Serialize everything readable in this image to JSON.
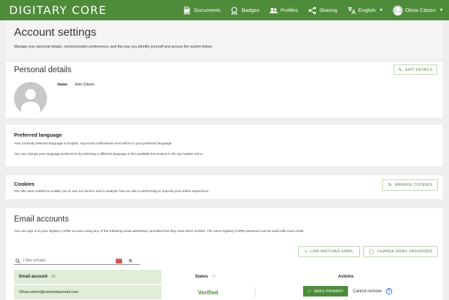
{
  "header": {
    "logo": "DIGITARY CORE",
    "nav": {
      "documents": "Documents",
      "badges": "Badges",
      "profiles": "Profiles",
      "sharing": "Sharing",
      "language": "English",
      "user": "Olivia Citizen"
    }
  },
  "page": {
    "title": "Account settings",
    "description": "Manage your personal details, communication preferences, and the way you identify yourself and access the system below."
  },
  "personal": {
    "title": "Personal details",
    "edit_label": "EDIT DETAILS",
    "name_label": "Name",
    "name_value": "John Citizen"
  },
  "language": {
    "title": "Preferred language",
    "line1": "Your currently selected language is English. Any email notifications sent will be in your preferred language.",
    "line2": "You can change your language preference by selecting a different language in the available list located in the top header menu."
  },
  "cookies": {
    "title": "Cookies",
    "text": "Our site uses cookies to enable you to use our service and to analyse how our site is performing to improve your online experience.",
    "manage_label": "MANAGE COOKIES"
  },
  "emails": {
    "title": "Email accounts",
    "description": "You can sign in to your Digitary CORE account using any of the following email addresses, provided that they have been verified. The same Digitary CORE password can be used with each email.",
    "filter_placeholder": "Filter emails",
    "link_label": "LINK ANOTHER EMAIL",
    "change_pw_label": "CHANGE EMAIL PASSWORD",
    "columns": {
      "email": "Email account",
      "status": "Status",
      "actions": "Actions"
    },
    "rows": [
      {
        "email": "Olivia.citizen@universityemail.com",
        "status": "Verified",
        "primary_label": "MAKE PRIMARY",
        "remove_text": "Cannot remove"
      }
    ]
  },
  "colors": {
    "brand_green": "#4e8b3a",
    "row_highlight": "#e0edd7",
    "help_blue": "#2b6fc2"
  },
  "icons": [
    "documents-icon",
    "badges-icon",
    "profiles-icon",
    "sharing-icon",
    "translate-icon",
    "pencil-icon",
    "plus-icon",
    "shield-icon",
    "search-icon",
    "close-icon",
    "sort-icon",
    "star-icon",
    "help-icon"
  ]
}
